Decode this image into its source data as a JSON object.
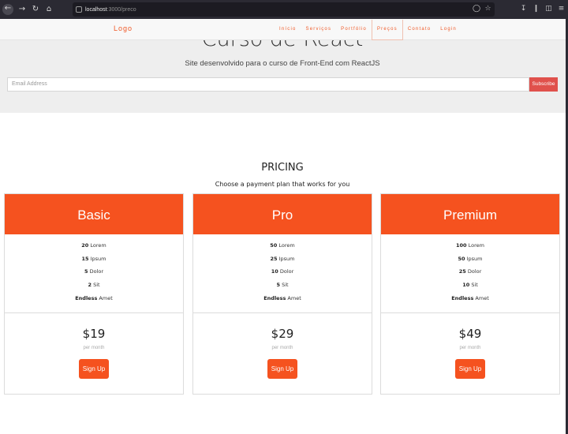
{
  "browser": {
    "url_host": "localhost",
    "url_path": ":3000/preco",
    "icons": [
      "back-icon",
      "forward-icon",
      "reload-icon",
      "home-icon",
      "pocket-icon",
      "star-icon",
      "download-icon",
      "library-icon",
      "sidebar-icon",
      "menu-icon"
    ]
  },
  "nav": {
    "logo": "Logo",
    "links": [
      {
        "label": "Início",
        "active": false
      },
      {
        "label": "Serviços",
        "active": false
      },
      {
        "label": "Portfólio",
        "active": false
      },
      {
        "label": "Preços",
        "active": true
      },
      {
        "label": "Contato",
        "active": false
      },
      {
        "label": "Login",
        "active": false
      }
    ]
  },
  "hero": {
    "title": "Curso de React",
    "subtitle": "Site desenvolvido para o curso de Front-End com ReactJS",
    "email_placeholder": "Email Address",
    "subscribe_label": "Subscribe"
  },
  "pricing": {
    "title": "PRICING",
    "subtitle": "Choose a payment plan that works for you",
    "plans": [
      {
        "name": "Basic",
        "features": [
          {
            "value": "20",
            "label": "Lorem"
          },
          {
            "value": "15",
            "label": "Ipsum"
          },
          {
            "value": "5",
            "label": "Dolor"
          },
          {
            "value": "2",
            "label": "Sit"
          },
          {
            "value": "Endless",
            "label": "Amet"
          }
        ],
        "price": "$19",
        "period": "per month",
        "cta": "Sign Up"
      },
      {
        "name": "Pro",
        "features": [
          {
            "value": "50",
            "label": "Lorem"
          },
          {
            "value": "25",
            "label": "Ipsum"
          },
          {
            "value": "10",
            "label": "Dolor"
          },
          {
            "value": "5",
            "label": "Sit"
          },
          {
            "value": "Endless",
            "label": "Amet"
          }
        ],
        "price": "$29",
        "period": "per month",
        "cta": "Sign Up"
      },
      {
        "name": "Premium",
        "features": [
          {
            "value": "100",
            "label": "Lorem"
          },
          {
            "value": "50",
            "label": "Ipsum"
          },
          {
            "value": "25",
            "label": "Dolor"
          },
          {
            "value": "10",
            "label": "Sit"
          },
          {
            "value": "Endless",
            "label": "Amet"
          }
        ],
        "price": "$49",
        "period": "per month",
        "cta": "Sign Up"
      }
    ]
  },
  "colors": {
    "accent": "#f5521f",
    "subscribe": "#e0514c",
    "hero_bg": "#eeeeee"
  }
}
